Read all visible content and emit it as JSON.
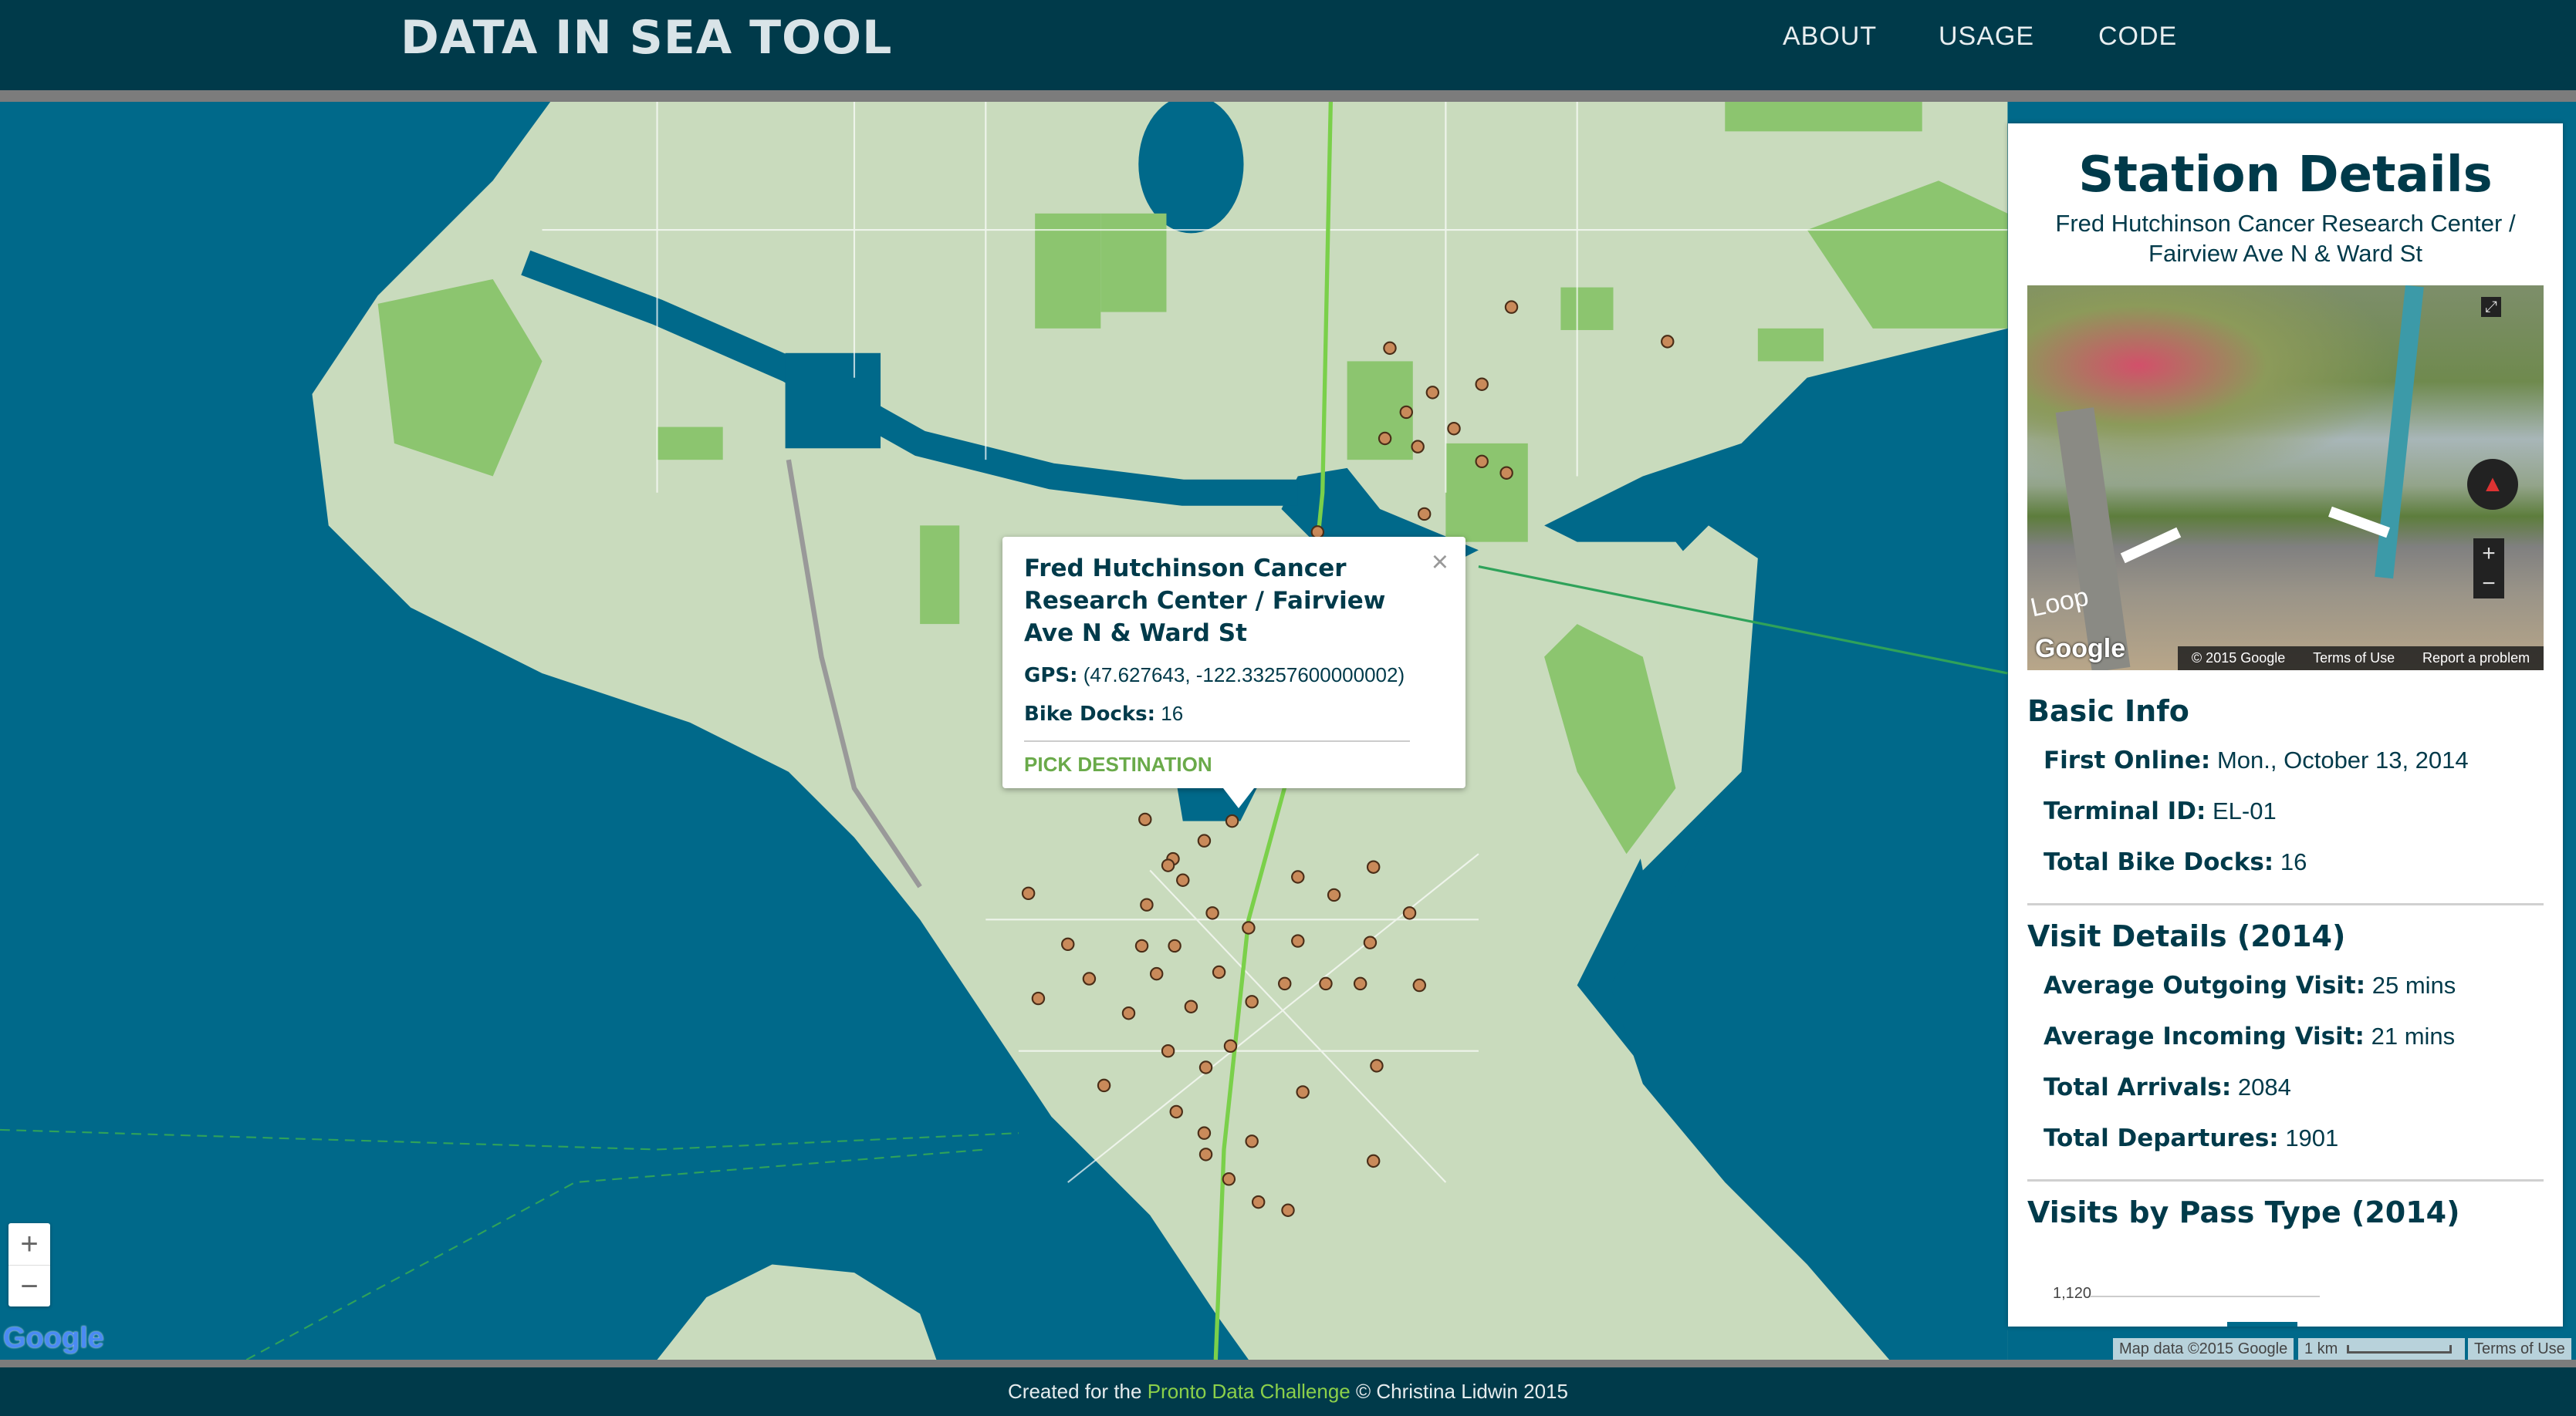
{
  "header": {
    "title": "DATA IN SEA TOOL",
    "nav": [
      "ABOUT",
      "USAGE",
      "CODE"
    ]
  },
  "colors": {
    "header": "#003a4a",
    "water": "#00698a",
    "land": "#c9dbbd",
    "park": "#8cc56f",
    "marker": "#c98a5a",
    "accent_green": "#6aaa4a"
  },
  "popup": {
    "title": "Fred Hutchinson Cancer Research Center / Fairview Ave N & Ward St",
    "gps_label": "GPS:",
    "gps_value": "(47.627643, -122.33257600000002)",
    "docks_label": "Bike Docks:",
    "docks_value": "16",
    "action": "PICK DESTINATION",
    "close": "×"
  },
  "panel": {
    "title": "Station Details",
    "subtitle": "Fred Hutchinson Cancer Research Center / Fairview Ave N & Ward St",
    "streetview": {
      "street_label": "Loop",
      "logo": "Google",
      "copyright": "© 2015 Google",
      "terms": "Terms of Use",
      "report": "Report a problem",
      "zoom_in": "+",
      "zoom_out": "−"
    },
    "basic_info": {
      "heading": "Basic Info",
      "items": [
        {
          "label": "First Online:",
          "value": "Mon., October 13, 2014"
        },
        {
          "label": "Terminal ID:",
          "value": "EL-01"
        },
        {
          "label": "Total Bike Docks:",
          "value": "16"
        }
      ]
    },
    "visit_details": {
      "heading": "Visit Details (2014)",
      "items": [
        {
          "label": "Average Outgoing Visit:",
          "value": "25 mins"
        },
        {
          "label": "Average Incoming Visit:",
          "value": "21 mins"
        },
        {
          "label": "Total Arrivals:",
          "value": "2084"
        },
        {
          "label": "Total Departures:",
          "value": "1901"
        }
      ]
    },
    "pass_type": {
      "heading": "Visits by Pass Type (2014)",
      "y_tick": "1,120",
      "bar_color": "#006a8a"
    }
  },
  "map": {
    "zoom_in": "+",
    "zoom_out": "−",
    "logo": "Google",
    "attribution": "Map data ©2015 Google",
    "scale": "1 km",
    "terms": "Terms of Use"
  },
  "footer": {
    "prefix": "Created for the",
    "link": "Pronto Data Challenge",
    "suffix": "© Christina Lidwin 2015"
  }
}
